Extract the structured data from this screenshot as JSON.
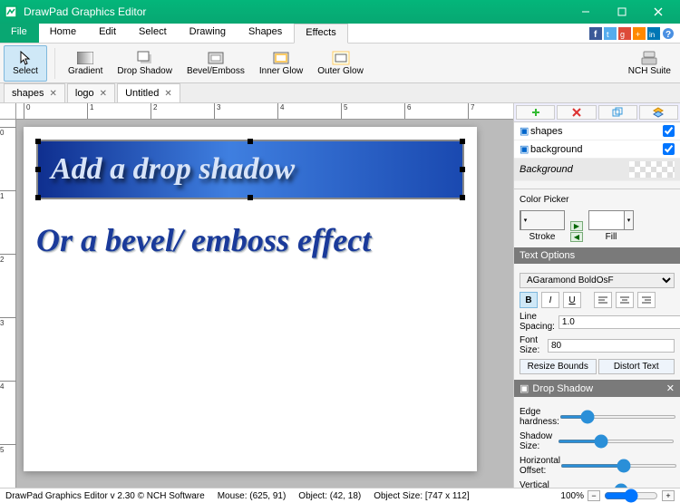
{
  "window": {
    "title": "DrawPad Graphics Editor"
  },
  "menu": {
    "items": [
      "File",
      "Home",
      "Edit",
      "Select",
      "Drawing",
      "Shapes",
      "Effects"
    ],
    "active": "Effects"
  },
  "ribbon": {
    "select": "Select",
    "gradient": "Gradient",
    "drop_shadow": "Drop Shadow",
    "bevel": "Bevel/Emboss",
    "inner_glow": "Inner Glow",
    "outer_glow": "Outer Glow",
    "suite": "NCH Suite"
  },
  "tabs": [
    {
      "label": "shapes",
      "active": false
    },
    {
      "label": "logo",
      "active": false
    },
    {
      "label": "Untitled",
      "active": true
    }
  ],
  "canvas": {
    "banner_text": "Add a drop shadow",
    "bevel_text": "Or a bevel/ emboss effect"
  },
  "layers": {
    "items": [
      {
        "name": "shapes",
        "visible": true
      },
      {
        "name": "background",
        "visible": true
      }
    ],
    "bg_label": "Background"
  },
  "color_picker": {
    "title": "Color Picker",
    "stroke_label": "Stroke",
    "stroke_color": "#a9d4f5",
    "fill_label": "Fill",
    "fill_color": "#ffffff"
  },
  "text_options": {
    "title": "Text Options",
    "font": "AGaramond BoldOsF",
    "line_spacing_label": "Line Spacing:",
    "line_spacing": "1.0",
    "font_size_label": "Font Size:",
    "font_size": "80",
    "resize": "Resize Bounds",
    "distort": "Distort Text"
  },
  "drop_shadow": {
    "title": "Drop Shadow",
    "edge": "Edge hardness:",
    "size": "Shadow Size:",
    "hoff": "Horizontal Offset:",
    "voff": "Vertical Offset:"
  },
  "status": {
    "app": "DrawPad Graphics Editor v 2.30  © NCH Software",
    "mouse": "Mouse: (625, 91)",
    "object": "Object: (42, 18)",
    "size": "Object Size: [747 x 112]",
    "zoom": "100%"
  }
}
